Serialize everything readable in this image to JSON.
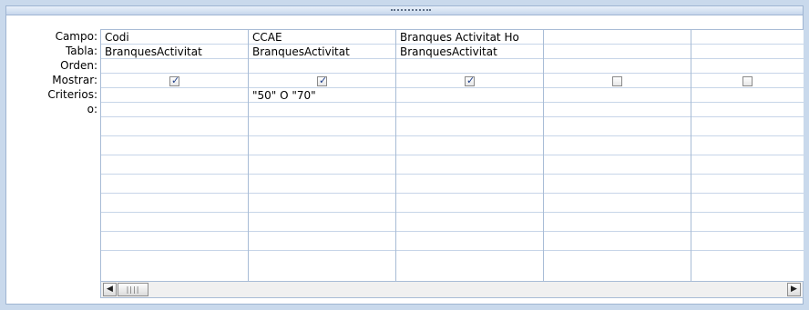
{
  "row_labels": [
    "Campo:",
    "Tabla:",
    "Orden:",
    "Mostrar:",
    "Criterios:",
    "o:"
  ],
  "columns": [
    {
      "campo": "Codi",
      "tabla": "BranquesActivitat",
      "orden": "",
      "mostrar": true,
      "criterios": "",
      "o": ""
    },
    {
      "campo": "CCAE",
      "tabla": "BranquesActivitat",
      "orden": "",
      "mostrar": true,
      "criterios": "\"50\" O \"70\"",
      "o": ""
    },
    {
      "campo": "Branques Activitat Ho",
      "tabla": "BranquesActivitat",
      "orden": "",
      "mostrar": true,
      "criterios": "",
      "o": ""
    },
    {
      "campo": "",
      "tabla": "",
      "orden": "",
      "mostrar": false,
      "criterios": "",
      "o": ""
    },
    {
      "campo": "",
      "tabla": "",
      "orden": "",
      "mostrar": false,
      "criterios": "",
      "o": ""
    }
  ],
  "scrollbar": {
    "left_arrow_icon": "scroll-left-icon",
    "right_arrow_icon": "scroll-right-icon"
  }
}
